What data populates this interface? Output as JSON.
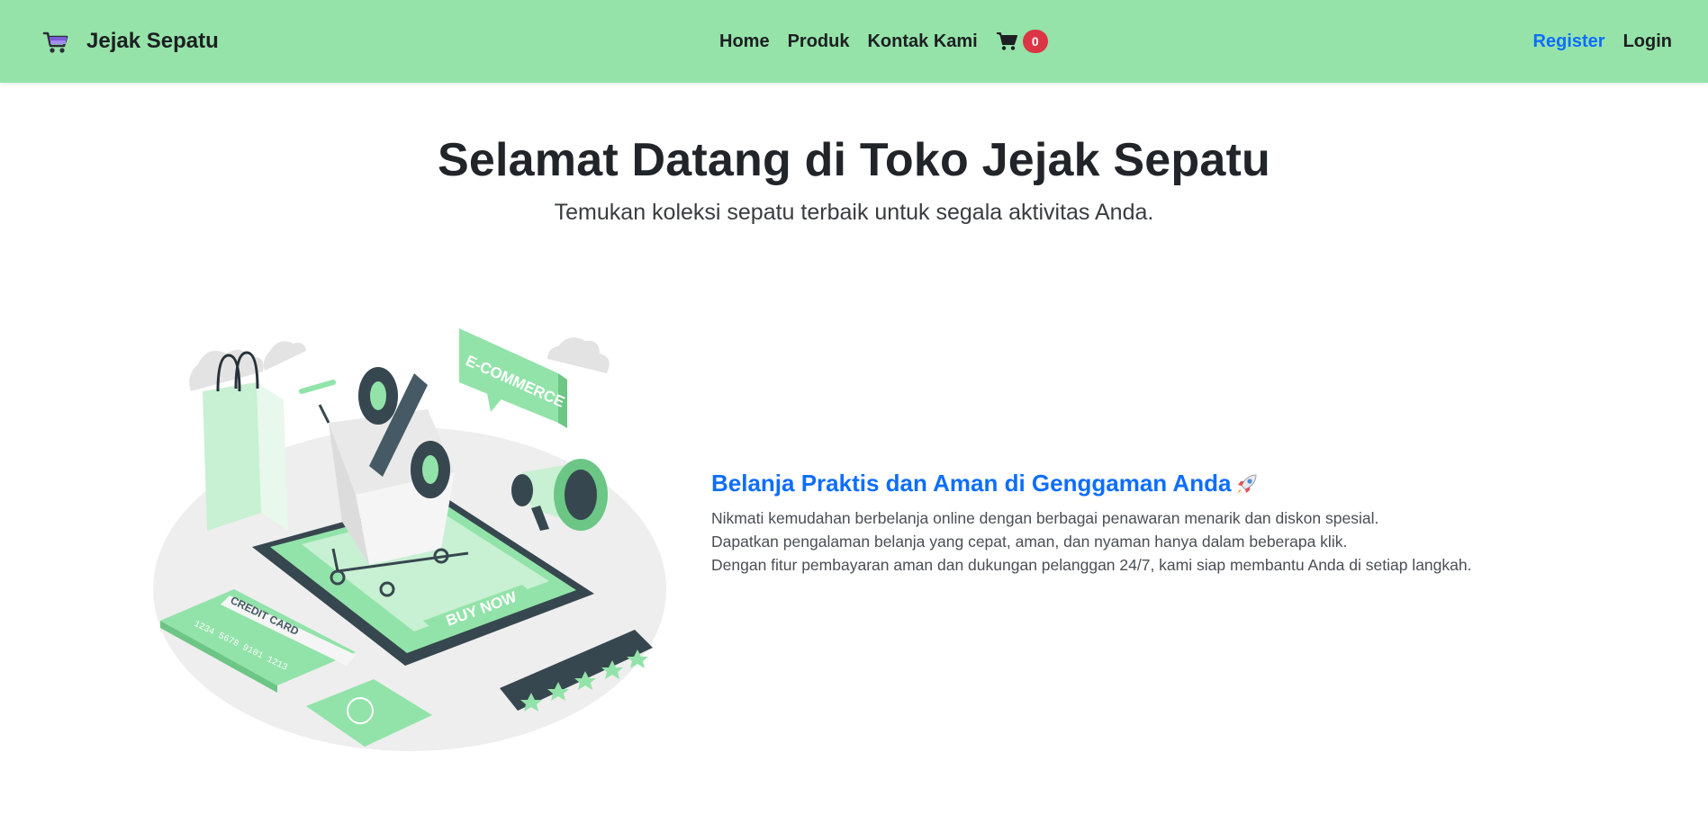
{
  "navbar": {
    "brand": "Jejak Sepatu",
    "links": [
      "Home",
      "Produk",
      "Kontak Kami"
    ],
    "cart_count": "0",
    "register": "Register",
    "login": "Login"
  },
  "hero": {
    "title": "Selamat Datang di Toko Jejak Sepatu",
    "subtitle": "Temukan koleksi sepatu terbaik untuk segala aktivitas Anda."
  },
  "illustration": {
    "bubble_text": "E-COMMERCE",
    "button_text": "BUY NOW",
    "card_text": "CREDIT CARD",
    "card_number": "1234 5678 9101 1213"
  },
  "feature": {
    "title": "Belanja Praktis dan Aman di Genggaman Anda",
    "lines": [
      "Nikmati kemudahan berbelanja online dengan berbagai penawaran menarik dan diskon spesial.",
      "Dapatkan pengalaman belanja yang cepat, aman, dan nyaman hanya dalam beberapa klik.",
      "Dengan fitur pembayaran aman dan dukungan pelanggan 24/7, kami siap membantu Anda di setiap langkah."
    ]
  },
  "colors": {
    "navbar_bg": "#95e3a9",
    "accent_blue": "#0d6efd",
    "badge_red": "#dc3545",
    "illustration_green": "#92e3a9"
  },
  "icons": [
    "cart-logo-icon",
    "shopping-cart-icon",
    "rocket-icon"
  ]
}
